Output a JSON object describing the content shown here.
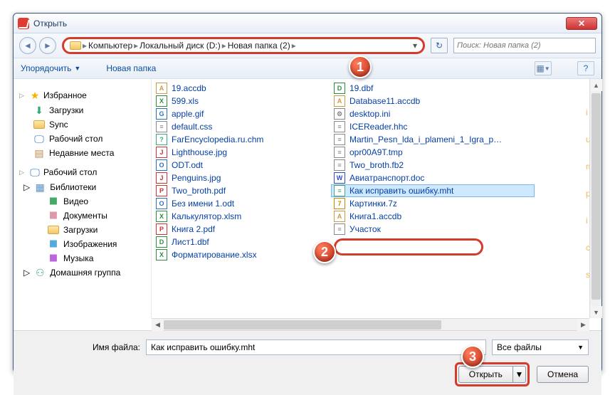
{
  "window": {
    "title": "Открыть",
    "close": "✕"
  },
  "nav": {
    "crumbs": [
      "Компьютер",
      "Локальный диск (D:)",
      "Новая папка (2)"
    ],
    "search_placeholder": "Поиск: Новая папка (2)",
    "refresh": "↻"
  },
  "toolbar": {
    "organize": "Упорядочить",
    "newfolder": "Новая папка",
    "views_icon": "▦",
    "help_icon": "?"
  },
  "sidebar": {
    "fav_hdr": "Избранное",
    "fav": [
      "Загрузки",
      "Sync",
      "Рабочий стол",
      "Недавние места"
    ],
    "desk_hdr": "Рабочий стол",
    "lib_hdr": "Библиотеки",
    "libs": [
      "Видео",
      "Документы",
      "Загрузки",
      "Изображения",
      "Музыка"
    ],
    "home_hdr": "Домашняя группа"
  },
  "files_col1": [
    {
      "name": "19.accdb",
      "ic": "A",
      "c": "#c94"
    },
    {
      "name": "599.xls",
      "ic": "X",
      "c": "#2a8f3c"
    },
    {
      "name": "apple.gif",
      "ic": "G",
      "c": "#2a6fbf"
    },
    {
      "name": "default.css",
      "ic": "≡",
      "c": "#888"
    },
    {
      "name": "FarEncyclopedia.ru.chm",
      "ic": "?",
      "c": "#3a7"
    },
    {
      "name": "Lighthouse.jpg",
      "ic": "J",
      "c": "#c33"
    },
    {
      "name": "ODT.odt",
      "ic": "O",
      "c": "#2a6fbf"
    },
    {
      "name": "Penguins.jpg",
      "ic": "J",
      "c": "#c33"
    },
    {
      "name": "Two_broth.pdf",
      "ic": "P",
      "c": "#c33"
    },
    {
      "name": "Без имени 1.odt",
      "ic": "O",
      "c": "#2a6fbf"
    },
    {
      "name": "Калькулятор.xlsm",
      "ic": "X",
      "c": "#2a8f3c"
    },
    {
      "name": "Книга 2.pdf",
      "ic": "P",
      "c": "#c33"
    },
    {
      "name": "Лист1.dbf",
      "ic": "D",
      "c": "#2a8f3c"
    },
    {
      "name": "Форматирование.xlsx",
      "ic": "X",
      "c": "#2a8f3c"
    }
  ],
  "files_col2": [
    {
      "name": "19.dbf",
      "ic": "D",
      "c": "#2a8f3c"
    },
    {
      "name": "Database11.accdb",
      "ic": "A",
      "c": "#c94"
    },
    {
      "name": "desktop.ini",
      "ic": "⚙",
      "c": "#888"
    },
    {
      "name": "ICEReader.hhc",
      "ic": "≡",
      "c": "#888"
    },
    {
      "name": "Martin_Pesn_lda_i_plameni_1_Igra_p…",
      "ic": "≡",
      "c": "#888"
    },
    {
      "name": "opr00A9T.tmp",
      "ic": "≡",
      "c": "#888"
    },
    {
      "name": "Two_broth.fb2",
      "ic": "≡",
      "c": "#888"
    },
    {
      "name": "Авиатранспорт.doc",
      "ic": "W",
      "c": "#2a4fbf"
    },
    {
      "name": "Как исправить ошибку.mht",
      "ic": "≡",
      "c": "#4a8",
      "sel": true
    },
    {
      "name": "Картинки.7z",
      "ic": "7",
      "c": "#c80"
    },
    {
      "name": "Книга1.accdb",
      "ic": "A",
      "c": "#c94"
    },
    {
      "name": "Участок",
      "ic": "≡",
      "c": "#888"
    }
  ],
  "footer": {
    "label": "Имя файла:",
    "value": "Как исправить ошибку.mht",
    "filter": "Все файлы",
    "open": "Открыть",
    "cancel": "Отмена"
  },
  "watermark": [
    "i",
    "u",
    "m",
    "p",
    "i",
    "c",
    "s"
  ],
  "callouts": {
    "1": "1",
    "2": "2",
    "3": "3"
  }
}
